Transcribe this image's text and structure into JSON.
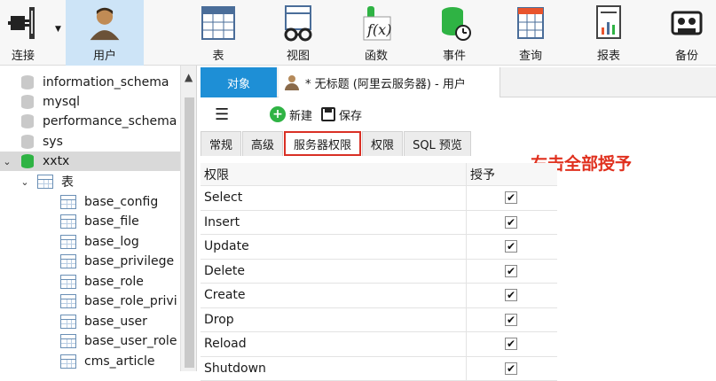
{
  "toolbar": {
    "items": [
      {
        "label": "连接",
        "icon": "plug-icon"
      },
      {
        "label": "用户",
        "icon": "user-icon"
      },
      {
        "label": "表",
        "icon": "table-icon"
      },
      {
        "label": "视图",
        "icon": "view-icon"
      },
      {
        "label": "函数",
        "icon": "function-icon"
      },
      {
        "label": "事件",
        "icon": "event-icon"
      },
      {
        "label": "查询",
        "icon": "query-icon"
      },
      {
        "label": "报表",
        "icon": "report-icon"
      },
      {
        "label": "备份",
        "icon": "backup-icon"
      }
    ]
  },
  "tree": {
    "items": [
      {
        "label": "information_schema"
      },
      {
        "label": "mysql"
      },
      {
        "label": "performance_schema"
      },
      {
        "label": "sys"
      },
      {
        "label": "xxtx"
      },
      {
        "label": "表"
      },
      {
        "label": "base_config"
      },
      {
        "label": "base_file"
      },
      {
        "label": "base_log"
      },
      {
        "label": "base_privilege"
      },
      {
        "label": "base_role"
      },
      {
        "label": "base_role_privi"
      },
      {
        "label": "base_user"
      },
      {
        "label": "base_user_role"
      },
      {
        "label": "cms_article"
      }
    ]
  },
  "tabs": {
    "object": "对象",
    "document": "* 无标题 (阿里云服务器) - 用户"
  },
  "actions": {
    "new": "新建",
    "save": "保存"
  },
  "subtabs": [
    "常规",
    "高级",
    "服务器权限",
    "权限",
    "SQL 预览"
  ],
  "hint": "右击全部授予",
  "grid": {
    "headers": [
      "权限",
      "授予"
    ],
    "rows": [
      {
        "name": "Select",
        "granted": "✔"
      },
      {
        "name": "Insert",
        "granted": "✔"
      },
      {
        "name": "Update",
        "granted": "✔"
      },
      {
        "name": "Delete",
        "granted": "✔"
      },
      {
        "name": "Create",
        "granted": "✔"
      },
      {
        "name": "Drop",
        "granted": "✔"
      },
      {
        "name": "Reload",
        "granted": "✔"
      },
      {
        "name": "Shutdown",
        "granted": "✔"
      }
    ]
  },
  "colors": {
    "accent": "#1e8fd6",
    "hint": "#e0301e",
    "active_toolbar": "#cde4f7"
  }
}
